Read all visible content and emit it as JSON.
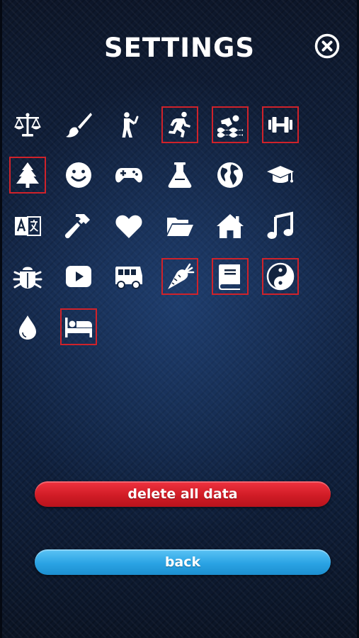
{
  "header": {
    "title": "SETTINGS",
    "close_icon": "close-circle-icon"
  },
  "icons": [
    {
      "name": "balance-scale-icon",
      "selected": false
    },
    {
      "name": "paint-brush-icon",
      "selected": false
    },
    {
      "name": "stretching-person-icon",
      "selected": false
    },
    {
      "name": "running-person-icon",
      "selected": true
    },
    {
      "name": "swimming-icon",
      "selected": true
    },
    {
      "name": "dumbbell-icon",
      "selected": true
    },
    {
      "name": "tree-icon",
      "selected": true
    },
    {
      "name": "smiley-face-icon",
      "selected": false
    },
    {
      "name": "gamepad-icon",
      "selected": false
    },
    {
      "name": "flask-icon",
      "selected": false
    },
    {
      "name": "globe-icon",
      "selected": false
    },
    {
      "name": "graduation-cap-icon",
      "selected": false
    },
    {
      "name": "translate-icon",
      "selected": false
    },
    {
      "name": "hammer-icon",
      "selected": false
    },
    {
      "name": "heart-icon",
      "selected": false
    },
    {
      "name": "folder-open-icon",
      "selected": false
    },
    {
      "name": "home-icon",
      "selected": false
    },
    {
      "name": "music-note-icon",
      "selected": false
    },
    {
      "name": "bug-icon",
      "selected": false
    },
    {
      "name": "play-button-icon",
      "selected": false
    },
    {
      "name": "bus-icon",
      "selected": false
    },
    {
      "name": "carrot-icon",
      "selected": true
    },
    {
      "name": "book-icon",
      "selected": true
    },
    {
      "name": "yin-yang-icon",
      "selected": true
    },
    {
      "name": "water-drop-icon",
      "selected": false
    },
    {
      "name": "bed-icon",
      "selected": true
    }
  ],
  "buttons": {
    "delete_label": "delete all data",
    "back_label": "back"
  },
  "colors": {
    "selection_border": "#d0222a",
    "delete_button": "#d11c26",
    "back_button": "#2aa3e4",
    "icon": "#ffffff"
  }
}
